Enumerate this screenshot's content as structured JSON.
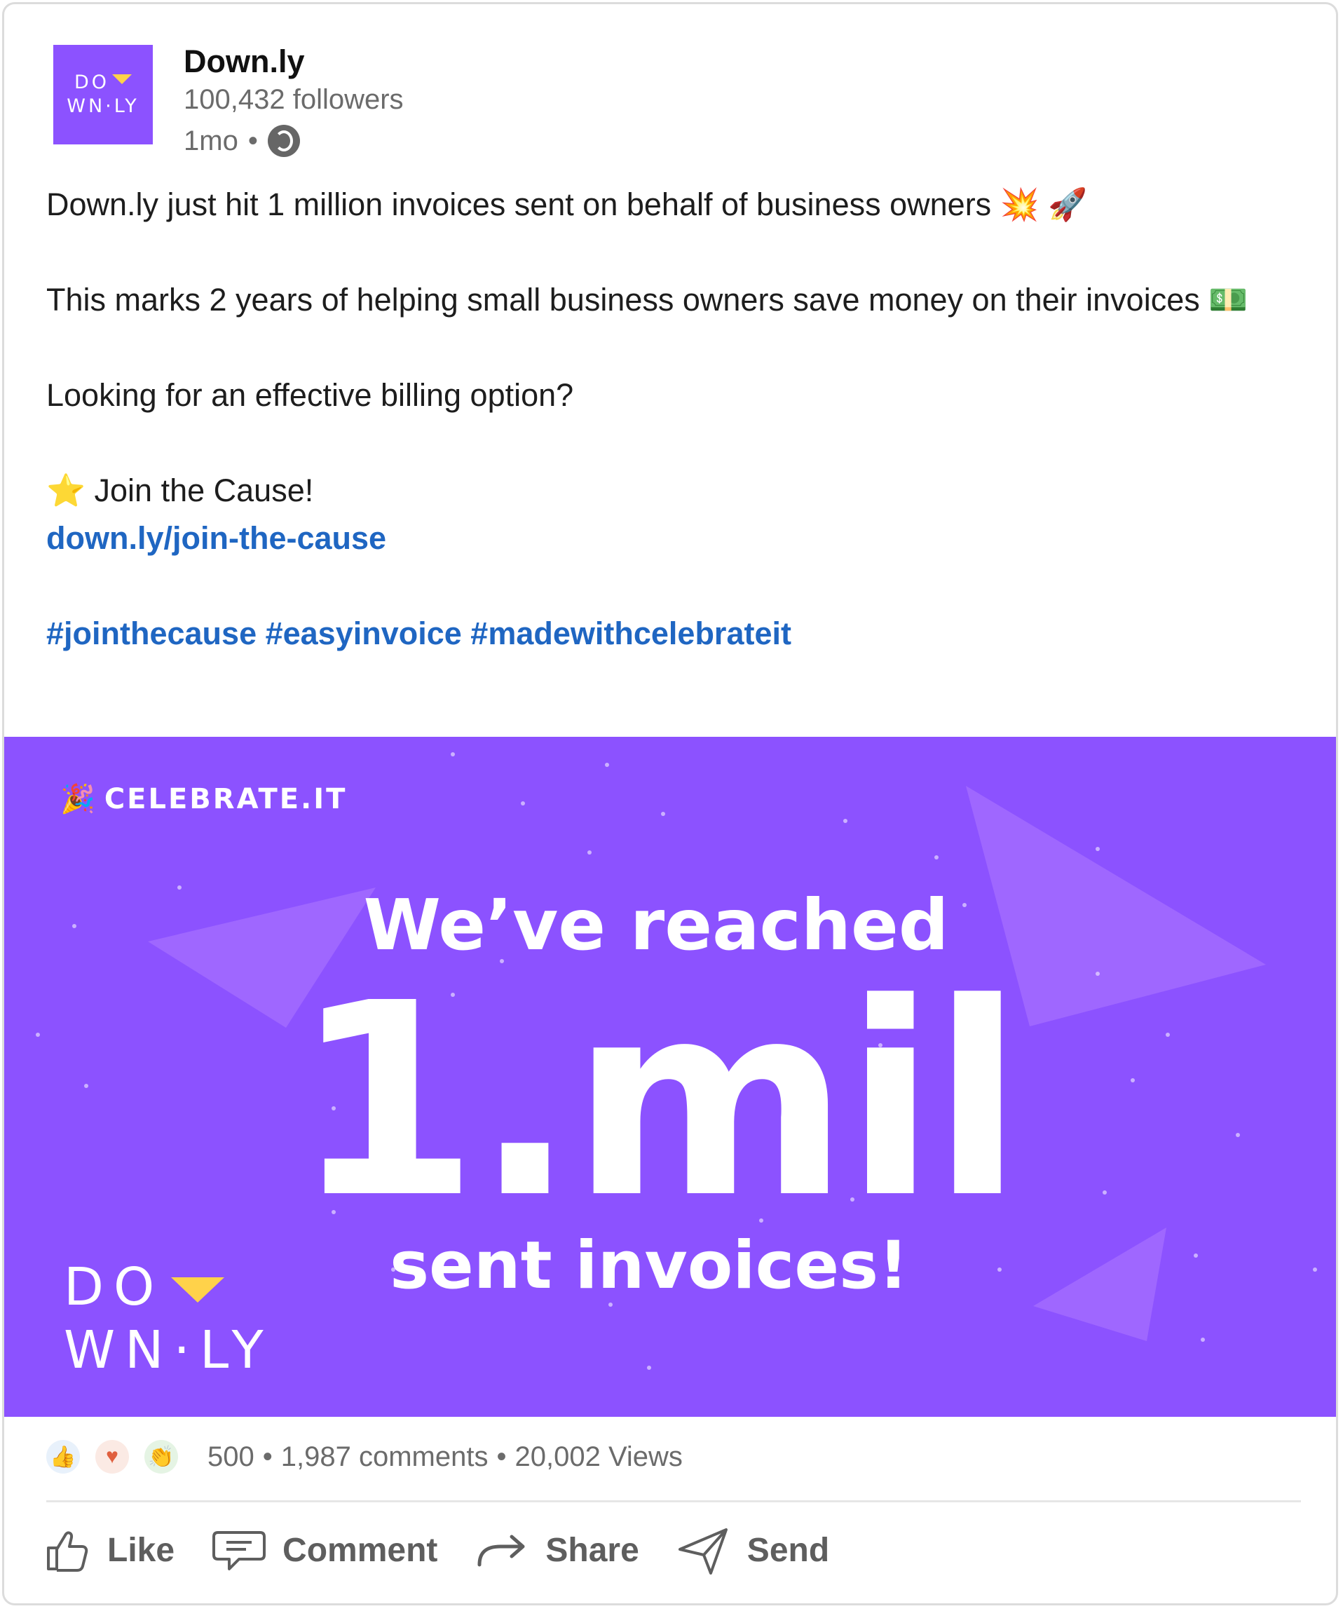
{
  "author": {
    "logo_line1": "DO",
    "logo_line2": "WN·LY",
    "name": "Down.ly",
    "followers": "100,432 followers",
    "time": "1mo",
    "visibility_icon": "globe-icon"
  },
  "post": {
    "line1": "Down.ly just hit 1 million invoices sent on behalf of business owners 💥 🚀",
    "line2": "This marks 2 years of helping small business owners save money on their invoices 💵",
    "line3": "Looking for an effective billing option?",
    "line4": "⭐ Join the Cause!",
    "link": "down.ly/join-the-cause",
    "hashtags": "#jointhecause #easyinvoice #madewithcelebrateit"
  },
  "banner": {
    "brand": "CELEBRATE.IT",
    "headline": "We’ve reached",
    "number": "1.mil",
    "subline": "sent invoices!",
    "logo_line1": "DO",
    "logo_line2": "WN·LY",
    "bg_color": "#8c52ff",
    "accent_color": "#ffd24a"
  },
  "stats": {
    "reactions_count": "500",
    "comments": "1,987 comments",
    "views": "20,002 Views",
    "reaction_icons": [
      "like-icon",
      "love-icon",
      "clap-icon"
    ]
  },
  "actions": {
    "like": "Like",
    "comment": "Comment",
    "share": "Share",
    "send": "Send"
  }
}
